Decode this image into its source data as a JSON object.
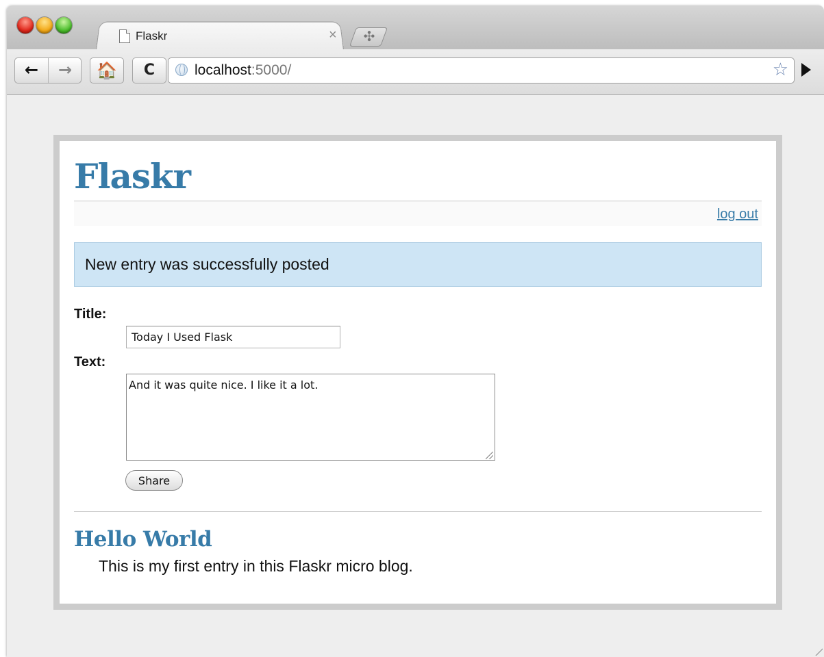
{
  "browser": {
    "tab": {
      "title": "Flaskr"
    },
    "new_tab_glyph": "✣",
    "toolbar": {
      "back_glyph": "←",
      "forward_glyph": "→",
      "home_glyph": "🏠",
      "reload_glyph": "C",
      "close_glyph": "×",
      "star_glyph": "☆"
    },
    "omnibox": {
      "host": "localhost",
      "port_path": ":5000/"
    }
  },
  "page": {
    "site_title": "Flaskr",
    "metanav": {
      "logout_label": "log out"
    },
    "flash_message": "New entry was successfully posted",
    "form": {
      "title_label": "Title:",
      "title_value": "Today I Used Flask",
      "text_label": "Text:",
      "text_value": "And it was quite nice. I like it a lot.",
      "submit_label": "Share"
    },
    "entries": [
      {
        "title": "Hello World",
        "text": "This is my first entry in this Flaskr micro blog."
      }
    ]
  },
  "colors": {
    "link": "#377ba8",
    "flash_bg": "#cee5f5",
    "page_border": "#cccccc",
    "background": "#eeeeee"
  }
}
